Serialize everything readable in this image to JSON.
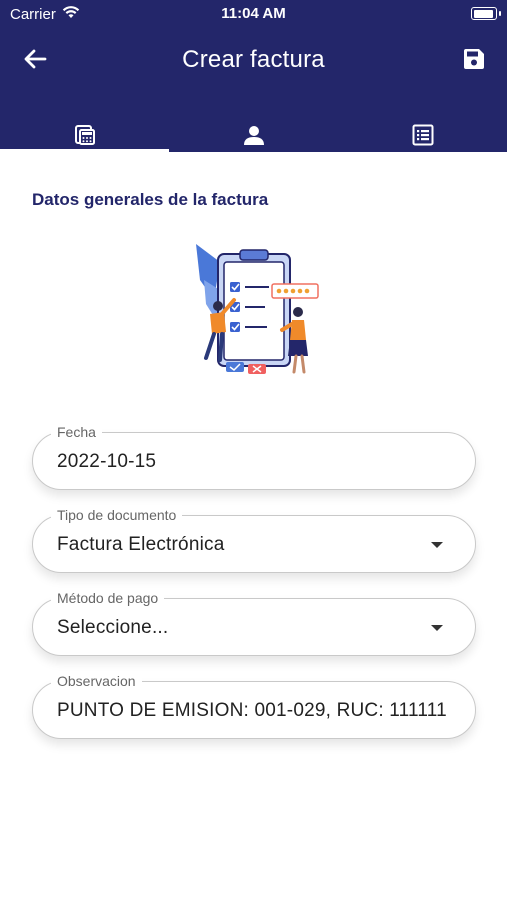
{
  "status_bar": {
    "carrier": "Carrier",
    "time": "11:04 AM"
  },
  "appbar": {
    "title": "Crear factura",
    "back_icon": "arrow-left-icon",
    "save_icon": "floppy-disk-icon"
  },
  "tabs": [
    {
      "icon": "calculator-icon",
      "active": true
    },
    {
      "icon": "person-icon",
      "active": false
    },
    {
      "icon": "list-icon",
      "active": false
    }
  ],
  "section": {
    "title": "Datos generales de la factura"
  },
  "form": {
    "fecha": {
      "label": "Fecha",
      "value": "2022-10-15"
    },
    "tipo_documento": {
      "label": "Tipo de documento",
      "value": "Factura Electrónica"
    },
    "metodo_pago": {
      "label": "Método de pago",
      "value": "Seleccione..."
    },
    "observacion": {
      "label": "Observacion",
      "value": "PUNTO DE EMISION: 001-029, RUC: 111111"
    }
  },
  "colors": {
    "primary": "#23266a",
    "accent": "#f0a030"
  }
}
